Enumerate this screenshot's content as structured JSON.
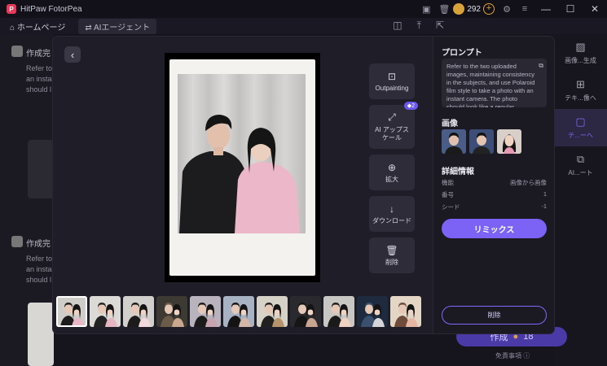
{
  "app": {
    "title": "HitPaw FotorPea",
    "coin_count": "292"
  },
  "nav": {
    "home_label": "ホームページ",
    "tab_label": "AIエージェント"
  },
  "background": {
    "card1_title": "作成完",
    "card1_lines": [
      "Refer to",
      "an insta",
      "should l"
    ],
    "card2_title": "作成完",
    "card2_lines": [
      "Refer to",
      "an insta",
      "should l"
    ]
  },
  "sidebar": {
    "items": [
      {
        "label": "画像...生成",
        "icon": "image-icon"
      },
      {
        "label": "テキ...像へ",
        "icon": "text-to-image-icon"
      },
      {
        "label": "テ...ーへ",
        "icon": "chat-icon"
      },
      {
        "label": "AI...ート",
        "icon": "agent-icon"
      }
    ]
  },
  "footer": {
    "generate_label": "作成",
    "generate_cost": "18",
    "note": "免責事項"
  },
  "modal": {
    "actions": [
      {
        "label": "Outpainting",
        "icon": "outpaint-icon"
      },
      {
        "label": "AI アップス\nケール",
        "icon": "upscale-icon",
        "badge": "2"
      },
      {
        "label": "拡大",
        "icon": "zoom-icon"
      },
      {
        "label": "ダウンロード",
        "icon": "download-icon"
      },
      {
        "label": "削除",
        "icon": "trash-icon"
      }
    ],
    "panel": {
      "prompt_title": "プロンプト",
      "prompt_text": "Refer to the two uploaded images, maintaining consistency in the subjects, and use Polaroid film style to take a photo with an instant camera. The photo should look like a regular photograph, without any",
      "images_title": "画像",
      "details_title": "詳細情報",
      "details": [
        {
          "key": "機能",
          "value": "画像から画像"
        },
        {
          "key": "番号",
          "value": "1"
        },
        {
          "key": "シード",
          "value": "-1"
        }
      ],
      "remix_label": "リミックス",
      "delete_label": "削除"
    },
    "thumbnail_count": 11
  }
}
